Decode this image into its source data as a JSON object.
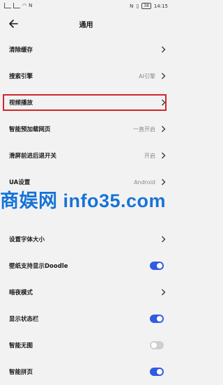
{
  "status_bar": {
    "left_text": "N",
    "battery": "38",
    "time": "14:15"
  },
  "header": {
    "title": "通用"
  },
  "settings": [
    {
      "label": "清除缓存",
      "value": "",
      "control": "chevron"
    },
    {
      "label": "搜索引擎",
      "value": "AI引擎",
      "control": "chevron"
    },
    {
      "label": "视频播放",
      "value": "",
      "control": "chevron",
      "highlighted": true
    },
    {
      "label": "智能预加载网页",
      "value": "一直开启",
      "control": "chevron"
    },
    {
      "label": "滑屏前进后退开关",
      "value": "开启",
      "control": "chevron"
    },
    {
      "label": "UA设置",
      "value": "Android",
      "control": "chevron"
    },
    {
      "label": "",
      "value": "",
      "control": "none"
    },
    {
      "label": "设置字体大小",
      "value": "",
      "control": "chevron"
    },
    {
      "label": "壁纸支持显示Doodle",
      "value": "",
      "control": "toggle",
      "state": "on"
    },
    {
      "label": "暗夜模式",
      "value": "",
      "control": "chevron"
    },
    {
      "label": "显示状态栏",
      "value": "",
      "control": "toggle",
      "state": "on"
    },
    {
      "label": "智能无图",
      "value": "",
      "control": "toggle",
      "state": "off"
    },
    {
      "label": "智能拼页",
      "value": "",
      "control": "toggle",
      "state": "on"
    }
  ],
  "watermark": "商娱网 info35.com",
  "colors": {
    "accent": "#2f5ce0",
    "highlight_border": "#d0262d",
    "watermark": "#1673d6"
  }
}
